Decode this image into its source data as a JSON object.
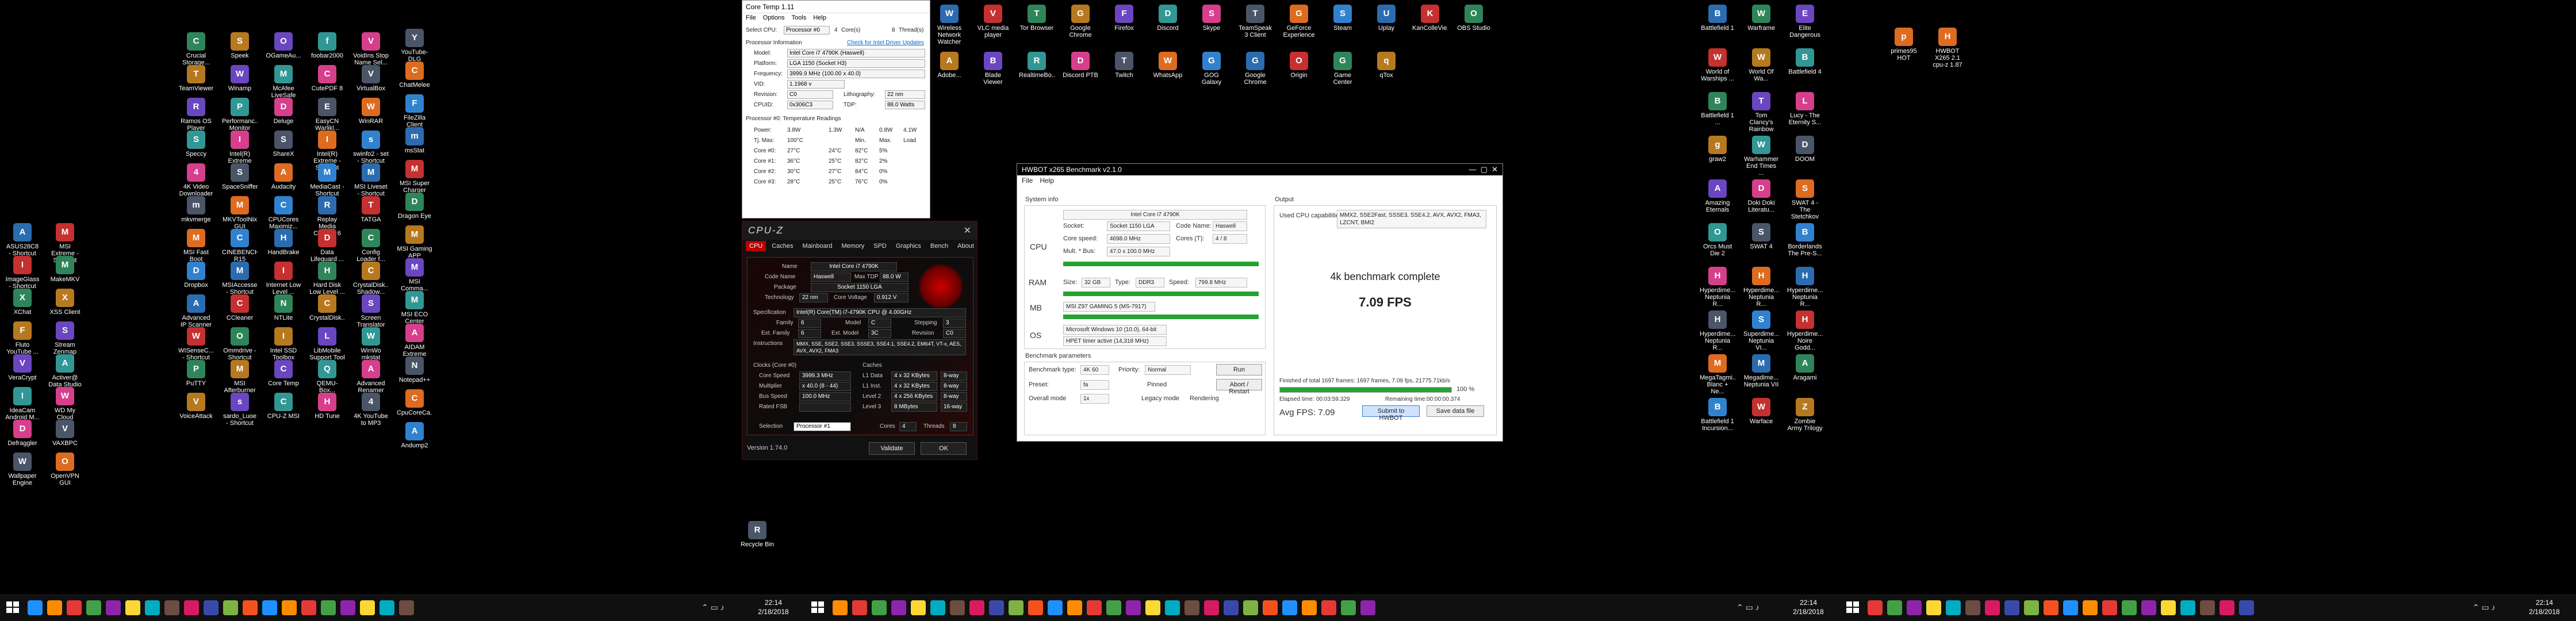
{
  "desktop": {
    "col1": [
      "ASUS28C8 - Shortcut",
      "ImageGlass - Shortcut",
      "XChat",
      "Fluto YouTube ...",
      "VeraCrypt",
      "IdeaCam Android M...",
      "Defraggler",
      "Wallpaper Engine"
    ],
    "col2": [
      "MSI Extreme - Shortcut",
      "MakeMKV",
      "XSS Client",
      "Stream Zenmap GUI",
      "Activer@ Data Studio",
      "WD My Cloud",
      "VAXBPC",
      "OpenVPN GUI"
    ],
    "col3": [
      "Crucial Storage...",
      "TeamViewer",
      "Ramos OS Player",
      "Speccy",
      "4K Video Downloader",
      "mkvmerge",
      "MSI Fast Boot",
      "Dropbox",
      "Advanced IP Scanner",
      "WISenseC... - Shortcut",
      "PuTTY",
      "VoiceAttack"
    ],
    "col4": [
      "Speek",
      "Winamp",
      "Performanc... Monitor",
      "Intel(R) Extreme Tu...",
      "SpaceSniffer",
      "MKVToolNix GUI",
      "CINEBENCH R15",
      "MSIAccesse - Shortcut",
      "CCleaner",
      "Ommdrive - Shortcut",
      "MSI Afterburner",
      "sardo_Luoe - Shortcut"
    ],
    "col5": [
      "OGameAu...",
      "McAfee LiveSafe",
      "Deluge",
      "ShareX",
      "Audacity",
      "CPUCores Maximiz...",
      "HandBrake",
      "Internet Low Level ...",
      "NTLite",
      "Intel SSD Toolbox",
      "Core Temp",
      "CPU-Z MSI"
    ],
    "col6": [
      "foobar2000",
      "CutePDF 8",
      "EasyCN Warlikl...",
      "Intel(R) Extreme - Shortcut",
      "MediaCast - Shortcut",
      "Replay Media Catcher 6",
      "Data Lifeguard ...",
      "Hard Disk Low Level ...",
      "CrystalDisk...",
      "LibMobile Support Tool",
      "QEMU-Box...",
      "HD Tune"
    ],
    "col7": [
      "VoidIns Stop Name Sel...",
      "VirtualBox",
      "WinRAR",
      "swinfo2 - set - Shortcut",
      "MSI Liveset - Shortcut",
      "TATGA",
      "Config Loader f...",
      "CrystalDisk... Shadow...",
      "Screen Translator",
      "WinWo mkstat",
      "Advanced Renamer",
      "4K YouTube to MP3"
    ],
    "col8": [
      "YouTube-DLG",
      "ChatMelee",
      "FileZilla Client",
      "msStat",
      "MSI Super Charger",
      "Dragon Eye",
      "MSI Gaming APP",
      "MSI Comma...",
      "MSI ECO Center",
      "AIDAM Extreme",
      "Notepad++",
      "CpuCoreCa...",
      "Andump2"
    ],
    "top1": [
      "Wireless Network Watcher",
      "VLC media player",
      "Tor Browser",
      "Google Chrome",
      "Firefox",
      "Discord",
      "Skype",
      "TeamSpeak 3 Client",
      "GeForce Experience",
      "Steam",
      "Uplay",
      "KanColleVie...",
      "OBS Studio"
    ],
    "top2": [
      "Adobe...",
      "Blade Viewer",
      "RealtimeBo...",
      "Discord PTB",
      "Twitch",
      "WhatsApp",
      "GOG Galaxy",
      "Google Chrome",
      "Origin",
      "Game Center",
      "qTox"
    ],
    "right1": [
      "Battlefield 1",
      "World of Warships ...",
      "Battlefield 1 ...",
      "graw2",
      "Amazing Eternals",
      "Orcs Must Die 2",
      "Hyperdime... Neptunia R...",
      "Hyperdime... Neptunia R...",
      "MegaTagmi... Blanc + Ne...",
      "Battlefield 1 Incursion..."
    ],
    "right2": [
      "Warframe",
      "World Of Wa...",
      "Tom Clancy's Rainbow Si...",
      "Warhammer End Times ...",
      "Doki Doki Literatu...",
      "SWAT 4",
      "Hyperdime... Neptunia R...",
      "Superdime... Neptunia VI...",
      "Megadime... Neptunia VII",
      "Warface"
    ],
    "right3": [
      "Elite Dangerous",
      "Battlefield 4",
      "Lucy - The Eternity S...",
      "DOOM",
      "SWAT 4 - The Stetchkov S...",
      "Borderlands The Pre-S...",
      "Hyperdime... Neptunia R...",
      "Hyperdime... Noire Godd...",
      "Aragami",
      "Zombie Army Trilogy"
    ],
    "files": [
      "primes95 HOT",
      "HWBOT X265 2.1 cpu-z 1.87"
    ],
    "recycle": "Recycle Bin"
  },
  "coretemp": {
    "title": "Core Temp 1.11",
    "menu": [
      "File",
      "Options",
      "Tools",
      "Help"
    ],
    "select_cpu": "Select CPU:",
    "processor": "Processor #0",
    "cores": "4",
    "cores_label": "Core(s)",
    "threads": "8",
    "threads_label": "Thread(s)",
    "proc_info": "Processor Information",
    "intel_link": "Check for Intel Driver Updates",
    "model": "Intel Core i7 4790K (Haswell)",
    "platform": "LGA 1150 (Socket H3)",
    "frequency": "3999.9 MHz (100.00 x 40.0)",
    "vid": "1.1968 v",
    "revision": "C0",
    "lithography": "22 nm",
    "cpuid": "0x306C3",
    "tdp": "88.0 Watts",
    "temps_title": "Processor #0: Temperature Readings",
    "power_row": [
      "Power:",
      "3.8W",
      "1.3W",
      "N/A",
      "0.8W",
      "4.1W"
    ],
    "tjmax_row": [
      "Tj. Max:",
      "100°C",
      "",
      "Min.",
      "Max.",
      "Load"
    ],
    "core_rows": [
      [
        "Core #0:",
        "27°C",
        "24°C",
        "82°C",
        "5%"
      ],
      [
        "Core #1:",
        "36°C",
        "25°C",
        "82°C",
        "2%"
      ],
      [
        "Core #2:",
        "30°C",
        "27°C",
        "84°C",
        "0%"
      ],
      [
        "Core #3:",
        "28°C",
        "25°C",
        "76°C",
        "0%"
      ]
    ]
  },
  "cpuz": {
    "title": "CPU-Z",
    "tabs": [
      "CPU",
      "Caches",
      "Mainboard",
      "Memory",
      "SPD",
      "Graphics",
      "Bench",
      "About"
    ],
    "name": "Intel Core i7 4790K",
    "codename": "Haswell",
    "max_tdp": "88.0 W",
    "package": "Socket 1150 LGA",
    "technology": "22 nm",
    "core_voltage": "0.912 V",
    "spec": "Intel(R) Core(TM) i7-4790K CPU @ 4.00GHz",
    "family": "6",
    "model": "C",
    "stepping": "3",
    "ext_family": "6",
    "ext_model": "3C",
    "revision": "C0",
    "instructions": "MMX, SSE, SSE2, SSE3, SSSE3, SSE4.1, SSE4.2, EM64T, VT-x, AES, AVX, AVX2, FMA3",
    "core_speed": "3999.3 MHz",
    "multiplier": "x 40.0 (8 - 44)",
    "bus_speed": "100.0 MHz",
    "rated_fsb": "",
    "l1d": "4 x 32 KBytes",
    "l1d_way": "8-way",
    "l1i": "4 x 32 KBytes",
    "l1i_way": "8-way",
    "l2": "4 x 256 KBytes",
    "l2_way": "8-way",
    "l3": "8 MBytes",
    "l3_way": "16-way",
    "selection": "Processor #1",
    "cores": "4",
    "threads": "8",
    "version": "Version 1.74.0",
    "validate": "Validate",
    "ok": "OK"
  },
  "hwbot": {
    "title": "HWBOT x265 Benchmark v2.1.0",
    "menu": [
      "File",
      "Help"
    ],
    "sysinfo": "System info",
    "output": "Output",
    "cpu_label": "CPU",
    "cpu_name": "Intel Core i7 4790K",
    "socket_label": "Socket:",
    "socket": "Socket 1150 LGA",
    "codename_label": "Code Name:",
    "codename": "Haswell",
    "corespeed_label": "Core speed:",
    "corespeed": "4698.0 MHz",
    "cores_label": "Cores (T):",
    "cores": "4 / 8",
    "mult_label": "Mult. * Bus:",
    "mult": "47.0 x 100.0 MHz",
    "ram_label": "RAM",
    "size_label": "Size:",
    "size": "32 GB",
    "type_label": "Type:",
    "type": "DDR3",
    "speed_label": "Speed:",
    "speed": "799.8 MHz",
    "mb_label": "MB",
    "mb": "MSI Z97 GAMING 5 (MS-7917)",
    "os_label": "OS",
    "os": "Microsoft Windows 10 (10.0), 64-bit",
    "timer": "HPET timer active (14,318 MHz)",
    "caps_label": "Used CPU capabilities:",
    "caps": "MMX2, SSE2Fast, SSSE3, SSE4.2, AVX, AVX2, FMA3, LZCNT, BMI2",
    "bench_params": "Benchmark parameters",
    "bench_type_label": "Benchmark type:",
    "bench_type": "4K 60",
    "priority_label": "Priority:",
    "priority": "Normal",
    "run": "Run",
    "preset_label": "Preset:",
    "preset": "fa",
    "pinned": "Pinned",
    "abort": "Abort / Restart",
    "overall_label": "Overall mode",
    "overall": "1x",
    "legacy": "Legacy mode",
    "rendering": "Rendering",
    "complete": "4k benchmark complete",
    "fps": "7.09 FPS",
    "finished": "Finished of total 1697 frames: 1697 frames, 7.09 fps, 21775.71kb/s",
    "progress": "100",
    "progress_text": "100 %",
    "elapsed_label": "Elapsed time:",
    "elapsed": "00:03:59.329",
    "remaining_label": "Remaining time:",
    "remaining": "00:00:00.374",
    "avg_label": "Avg FPS: 7.09",
    "submit": "Submit to HWBOT",
    "save": "Save data file"
  },
  "taskbars": [
    {
      "time": "22:14",
      "date": "2/18/2018"
    },
    {
      "time": "22:14",
      "date": "2/18/2018"
    },
    {
      "time": "22:14",
      "date": "2/18/2018"
    }
  ]
}
